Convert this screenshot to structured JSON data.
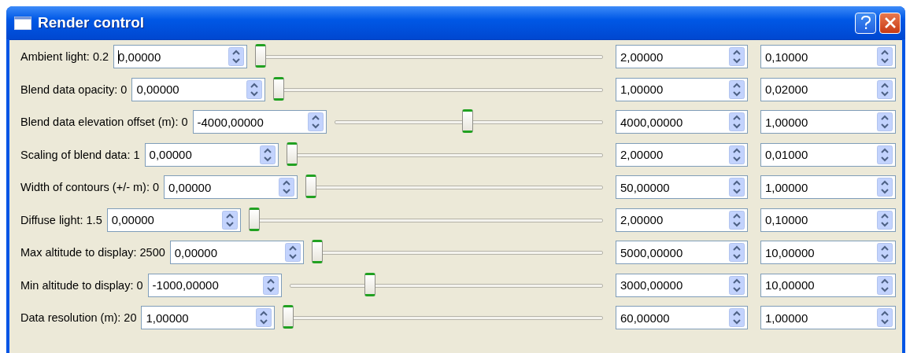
{
  "window": {
    "title": "Render control"
  },
  "rows": [
    {
      "label": "Ambient light: 0.2",
      "min": "0,00000",
      "focused": true,
      "level": 0,
      "max": "2,00000",
      "step": "0,10000"
    },
    {
      "label": "Blend data opacity: 0",
      "min": "0,00000",
      "focused": false,
      "level": 0,
      "max": "1,00000",
      "step": "0,02000"
    },
    {
      "label": "Blend data elevation offset (m): 0",
      "min": "-4000,00000",
      "focused": false,
      "level": 0.5,
      "max": "4000,00000",
      "step": "1,00000"
    },
    {
      "label": "Scaling of blend data: 1",
      "min": "0,00000",
      "focused": false,
      "level": 0,
      "max": "2,00000",
      "step": "0,01000"
    },
    {
      "label": "Width of contours (+/- m): 0",
      "min": "0,00000",
      "focused": false,
      "level": 0,
      "max": "50,00000",
      "step": "1,00000"
    },
    {
      "label": "Diffuse light: 1.5",
      "min": "0,00000",
      "focused": false,
      "level": 0,
      "max": "2,00000",
      "step": "0,10000"
    },
    {
      "label": "Max altitude to display: 2500",
      "min": "0,00000",
      "focused": false,
      "level": 0,
      "max": "5000,00000",
      "step": "10,00000"
    },
    {
      "label": "Min altitude to display: 0",
      "min": "-1000,00000",
      "focused": false,
      "level": 0.25,
      "max": "3000,00000",
      "step": "10,00000"
    },
    {
      "label": "Data resolution (m): 20",
      "min": "1,00000",
      "focused": false,
      "level": 0,
      "max": "60,00000",
      "step": "1,00000"
    }
  ]
}
